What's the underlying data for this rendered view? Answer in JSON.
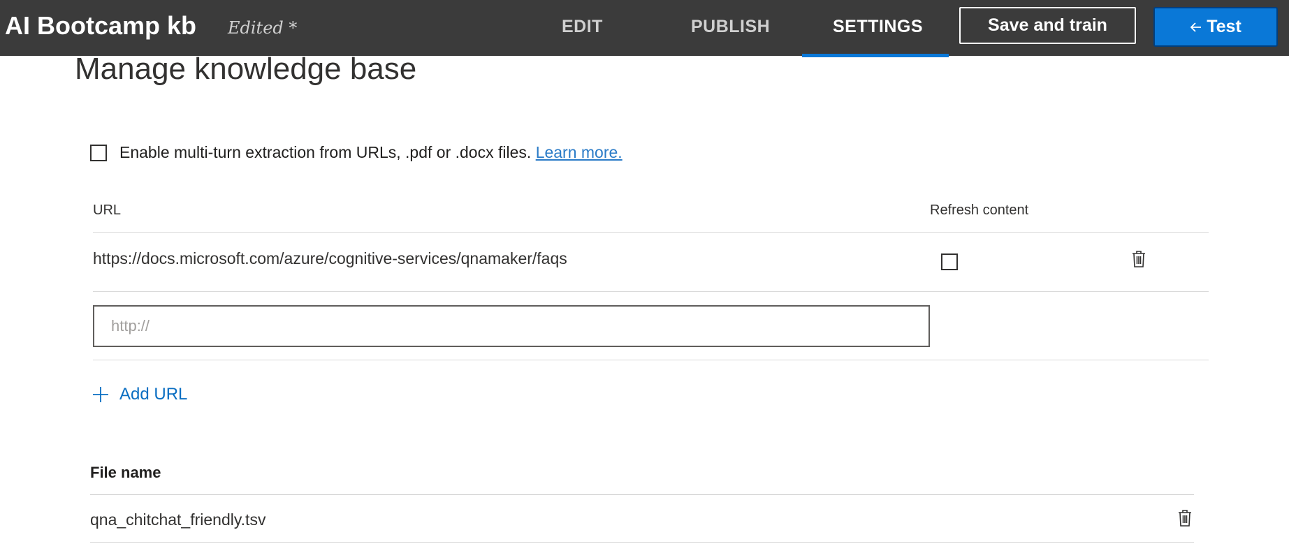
{
  "header": {
    "app_title": "AI Bootcamp kb",
    "edited_status": "Edited *",
    "tabs": [
      {
        "label": "EDIT",
        "active": false
      },
      {
        "label": "PUBLISH",
        "active": false
      },
      {
        "label": "SETTINGS",
        "active": true
      }
    ],
    "save_button_label": "Save and train",
    "test_button_label": "Test",
    "test_button_icon": "arrow-left-icon",
    "accent_color": "#0a78d7",
    "bar_color": "#3b3b3b"
  },
  "page": {
    "title": "Manage knowledge base",
    "multiturn": {
      "label": "Enable multi-turn extraction from URLs, .pdf or .docx files.",
      "link_text": "Learn more.",
      "checked": false
    }
  },
  "urls": {
    "columns": {
      "url": "URL",
      "refresh": "Refresh content"
    },
    "rows": [
      {
        "url": "https://docs.microsoft.com/azure/cognitive-services/qnamaker/faqs",
        "refresh_checked": false,
        "delete_icon": "trash-icon"
      }
    ],
    "new_url_placeholder": "http://",
    "new_url_value": "",
    "add_url_label": "Add URL",
    "add_url_icon": "plus-icon"
  },
  "files": {
    "column": "File name",
    "rows": [
      {
        "name": "qna_chitchat_friendly.tsv",
        "delete_icon": "trash-icon"
      }
    ]
  }
}
